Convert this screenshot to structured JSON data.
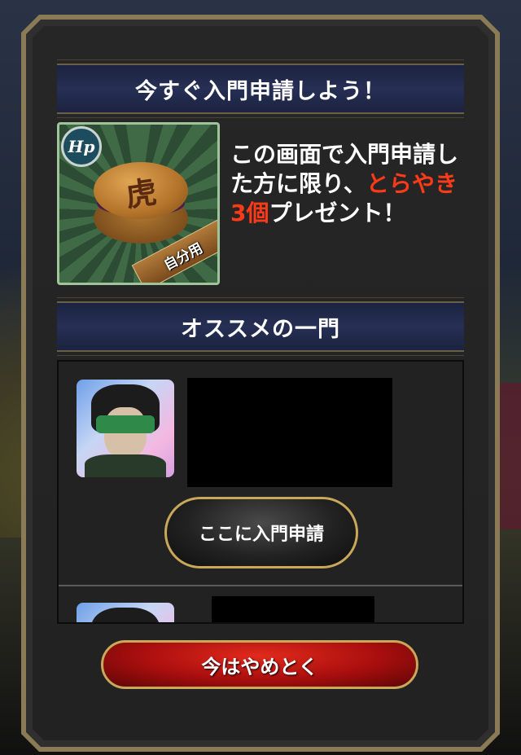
{
  "modal": {
    "header1": "今すぐ入門申請しよう！",
    "header2": "オススメの一門"
  },
  "item": {
    "badge": "Hp",
    "crest": "虎",
    "ribbon": "自分用"
  },
  "promo": {
    "text_before": "この画面で入門申請した方に限り、",
    "highlight": "とらやき3個",
    "text_after": "プレゼント！"
  },
  "recommended": {
    "join_button": "ここに入門申請"
  },
  "dismiss_button": "今はやめとく",
  "colors": {
    "highlight": "#ff3a18",
    "header_bg": "#262f55",
    "gold_border": "#c9a85a",
    "dismiss_red": "#a80e0e"
  }
}
